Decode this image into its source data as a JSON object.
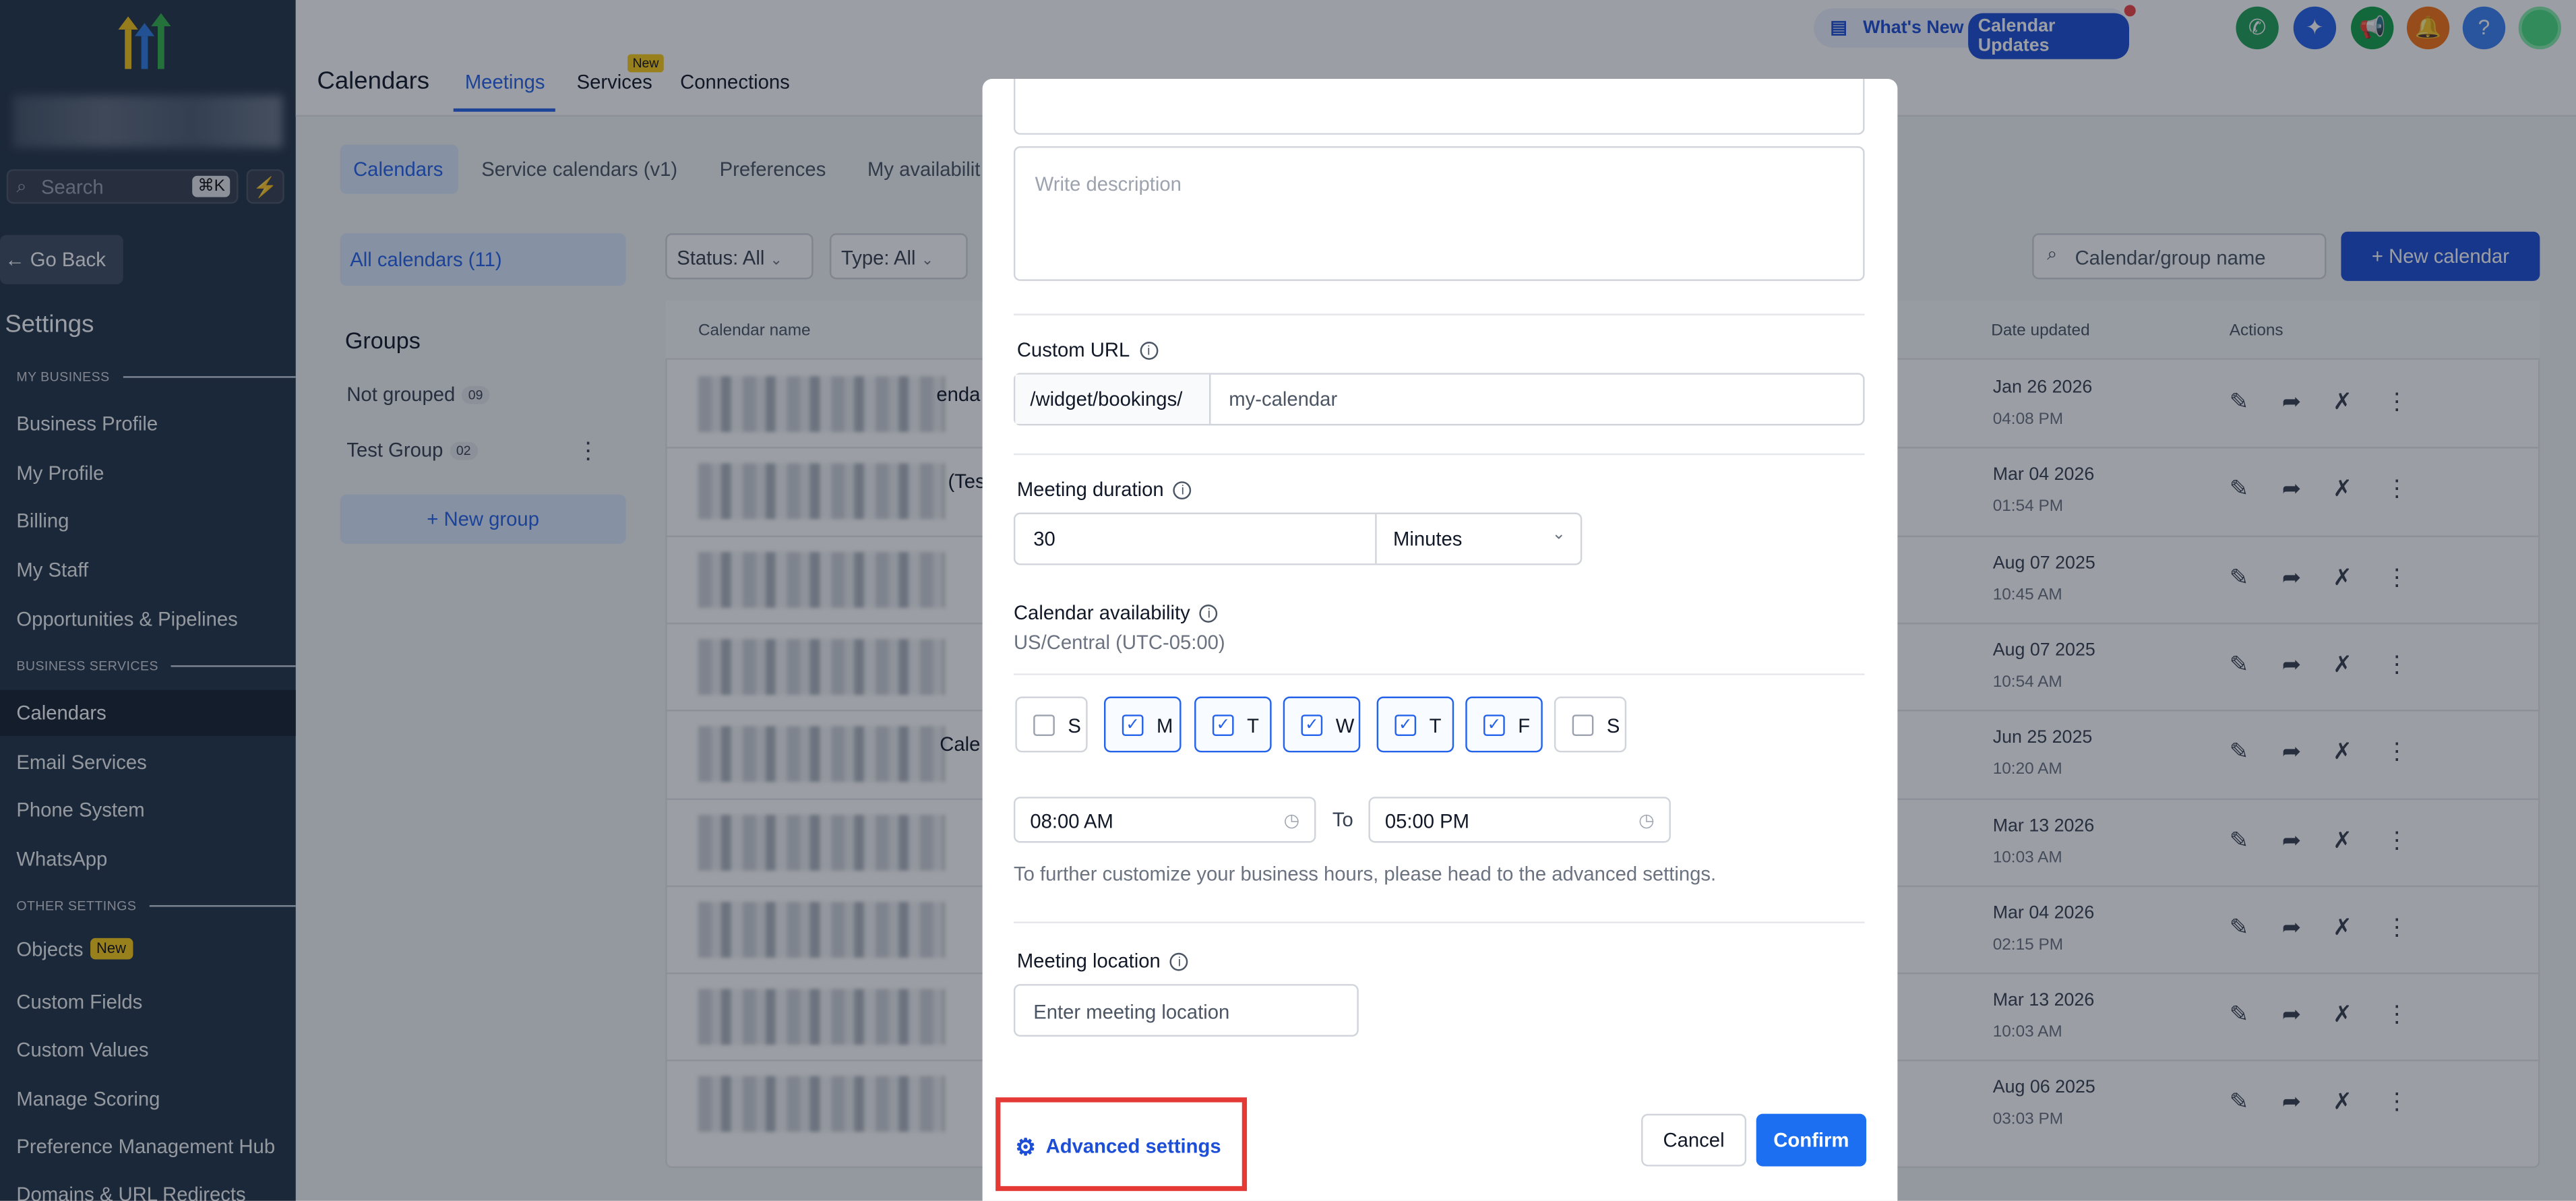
{
  "sidebar": {
    "search_placeholder": "Search",
    "search_shortcut": "⌘K",
    "go_back": "Go Back",
    "title": "Settings",
    "sections": {
      "my_business": "MY BUSINESS",
      "business_services": "BUSINESS SERVICES",
      "other_settings": "OTHER SETTINGS"
    },
    "items": [
      "Business Profile",
      "My Profile",
      "Billing",
      "My Staff",
      "Opportunities & Pipelines",
      "Calendars",
      "Email Services",
      "Phone System",
      "WhatsApp",
      "Objects",
      "Custom Fields",
      "Custom Values",
      "Manage Scoring",
      "Preference Management Hub",
      "Domains & URL Redirects"
    ],
    "active_item": "Calendars",
    "objects_badge": "New"
  },
  "header": {
    "title": "Calendars",
    "tabs": [
      "Meetings",
      "Services",
      "Connections"
    ],
    "active_tab": "Meetings",
    "services_badge": "New",
    "whats_new": "What's New",
    "calendar_updates": "Calendar Updates"
  },
  "content": {
    "subtabs": [
      "Calendars",
      "Service calendars (v1)",
      "Preferences",
      "My availabilit"
    ],
    "all_calendars": "All calendars (11)",
    "groups_title": "Groups",
    "groups": [
      {
        "name": "Not grouped",
        "count": "09"
      },
      {
        "name": "Test Group",
        "count": "02"
      }
    ],
    "new_group": "New group",
    "filters": {
      "status": "Status: All",
      "type": "Type: All"
    },
    "search_placeholder": "Calendar/group name",
    "new_calendar": "New calendar",
    "columns": {
      "name": "Calendar name",
      "date": "Date updated",
      "actions": "Actions"
    },
    "partial_name_fragments": [
      "enda",
      "(Tes",
      "Cale"
    ],
    "rows": [
      {
        "date": "Jan 26 2026",
        "time": "04:08 PM"
      },
      {
        "date": "Mar 04 2026",
        "time": "01:54 PM"
      },
      {
        "date": "Aug 07 2025",
        "time": "10:45 AM"
      },
      {
        "date": "Aug 07 2025",
        "time": "10:54 AM"
      },
      {
        "date": "Jun 25 2025",
        "time": "10:20 AM"
      },
      {
        "date": "Mar 13 2026",
        "time": "10:03 AM"
      },
      {
        "date": "Mar 04 2026",
        "time": "02:15 PM"
      },
      {
        "date": "Mar 13 2026",
        "time": "10:03 AM"
      },
      {
        "date": "Aug 06 2025",
        "time": "03:03 PM"
      }
    ]
  },
  "modal": {
    "description_placeholder": "Write description",
    "custom_url_label": "Custom URL",
    "url_prefix": "/widget/bookings/",
    "url_placeholder": "my-calendar",
    "duration_label": "Meeting duration",
    "duration_value": "30",
    "duration_unit": "Minutes",
    "availability_label": "Calendar availability",
    "timezone": "US/Central (UTC-05:00)",
    "days": [
      {
        "label": "S",
        "checked": false
      },
      {
        "label": "M",
        "checked": true
      },
      {
        "label": "T",
        "checked": true
      },
      {
        "label": "W",
        "checked": true
      },
      {
        "label": "T",
        "checked": true
      },
      {
        "label": "F",
        "checked": true
      },
      {
        "label": "S",
        "checked": false
      }
    ],
    "start_time": "08:00 AM",
    "to": "To",
    "end_time": "05:00 PM",
    "hours_hint": "To further customize your business hours, please head to the advanced settings.",
    "location_label": "Meeting location",
    "location_placeholder": "Enter meeting location",
    "advanced_settings": "Advanced settings",
    "cancel": "Cancel",
    "confirm": "Confirm"
  },
  "colors": {
    "primary": "#1d4ed8",
    "sidebar": "#243447",
    "highlight": "#e53935",
    "badge": "#facc15"
  }
}
